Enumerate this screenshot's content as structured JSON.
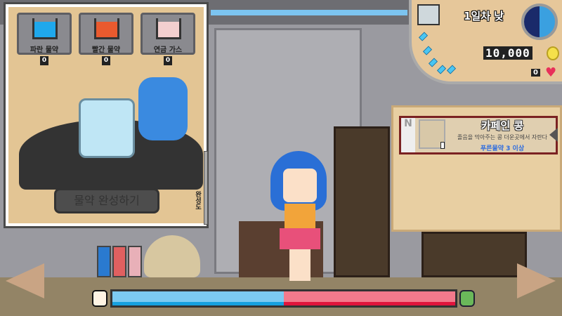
{
  "lab": {
    "ingredients": [
      {
        "label": "파란 물약",
        "count": "0",
        "color": "#1fa8ec"
      },
      {
        "label": "빨간 물약",
        "count": "0",
        "color": "#ea5a2e"
      },
      {
        "label": "연금 가스",
        "count": "0",
        "color": "#f3cfcf"
      }
    ],
    "complete_button": "물약 완성하기",
    "progress_label": "완성도"
  },
  "hud": {
    "day": "1일차 낮",
    "money": "10,000",
    "hearts": "0",
    "gems": 5
  },
  "item_card": {
    "tab": "N",
    "title": "카페인 콩",
    "description": "졸음을 막아주는 콩 더운곳에서 자란다",
    "requirement": "푸른물약 3 이상",
    "count": "I"
  },
  "balance_bar": {
    "blue_fraction": 0.5,
    "blue": "#7ccaf2",
    "red": "#f27a8c"
  },
  "colors": {
    "accent": "#2a6ae0"
  }
}
